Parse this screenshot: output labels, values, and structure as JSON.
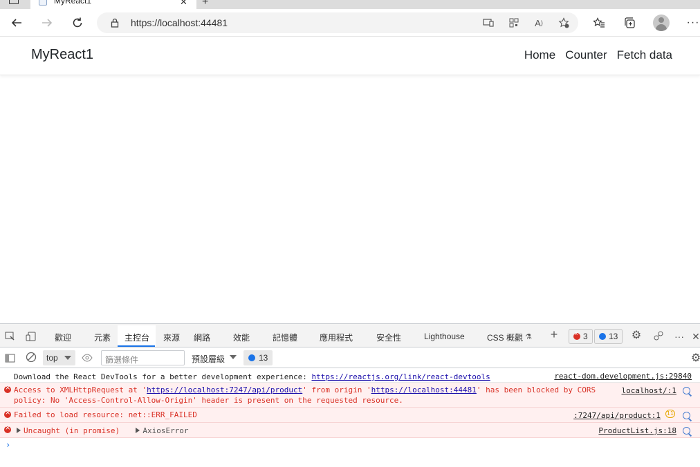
{
  "browser": {
    "tab_title": "MyReact1",
    "url": "https://localhost:44481"
  },
  "app": {
    "brand": "MyReact1",
    "nav": [
      "Home",
      "Counter",
      "Fetch data"
    ]
  },
  "devtools": {
    "tabs": [
      "歡迎",
      "元素",
      "主控台",
      "來源",
      "網路",
      "效能",
      "記憶體",
      "應用程式",
      "安全性",
      "Lighthouse",
      "CSS 概觀"
    ],
    "active_tab": "主控台",
    "error_count": "3",
    "info_count": "13",
    "context": "top",
    "filter_placeholder": "篩選條件",
    "levels": "預設層級",
    "msg_count": "13",
    "messages": [
      {
        "type": "log",
        "text": "Download the React DevTools for a better development experience: ",
        "link": "https://reactjs.org/link/react-devtools",
        "source": "react-dom.development.js:29840"
      },
      {
        "type": "error",
        "line1_a": "Access to XMLHttpRequest at '",
        "line1_link1": "https://localhost:7247/api/product",
        "line1_b": "' from origin '",
        "line1_link2": "https://localhost:44481",
        "line1_c": "' has been blocked by CORS",
        "line2": "policy: No 'Access-Control-Allow-Origin' header is present on the requested resource.",
        "source": "localhost/:1"
      },
      {
        "type": "error",
        "text": "Failed to load resource: net::ERR_FAILED",
        "source": ":7247/api/product:1",
        "badge": "11"
      },
      {
        "type": "error",
        "text": "Uncaught (in promise)",
        "object": "AxiosError",
        "source": "ProductList.js:18"
      }
    ]
  }
}
